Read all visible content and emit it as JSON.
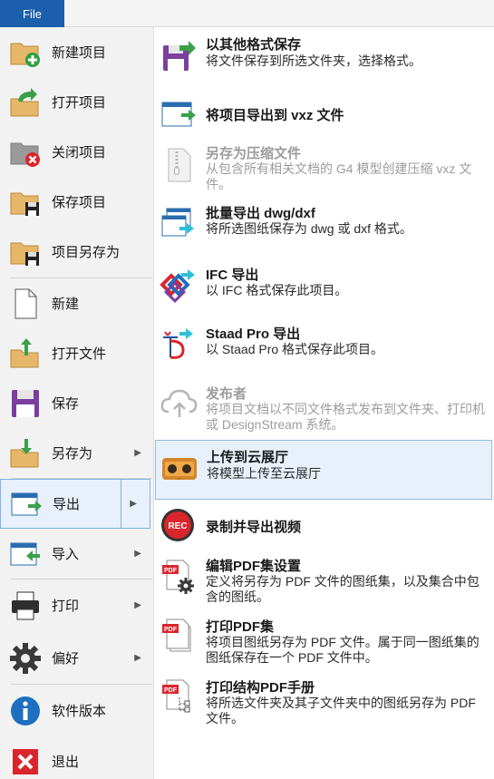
{
  "tab": {
    "label": "File"
  },
  "left_menu": {
    "new_project": "新建项目",
    "open_project": "打开项目",
    "close_project": "关闭项目",
    "save_project": "保存项目",
    "save_project_as": "项目另存为",
    "new": "新建",
    "open_file": "打开文件",
    "save": "保存",
    "save_as": "另存为",
    "export": "导出",
    "import": "导入",
    "print": "打印",
    "preferences": "偏好",
    "version": "软件版本",
    "exit": "退出"
  },
  "submenu": {
    "save_other_format": {
      "title": "以其他格式保存",
      "desc": "将文件保存到所选文件夹，选择格式。"
    },
    "export_vxz": {
      "title": "将项目导出到 vxz 文件",
      "desc": ""
    },
    "save_compressed": {
      "title": "另存为压缩文件",
      "desc": "从包含所有相关文档的 G4 模型创建压缩 vxz 文件。"
    },
    "batch_dwg": {
      "title": "批量导出 dwg/dxf",
      "desc": "将所选图纸保存为 dwg 或 dxf 格式。"
    },
    "ifc": {
      "title": "IFC 导出",
      "desc": "以 IFC 格式保存此项目。"
    },
    "staad": {
      "title": "Staad Pro 导出",
      "desc": "以 Staad Pro 格式保存此项目。"
    },
    "publisher": {
      "title": "发布者",
      "desc": "将项目文档以不同文件格式发布到文件夹、打印机或 DesignStream 系统。"
    },
    "cloud": {
      "title": "上传到云展厅",
      "desc": "将模型上传至云展厅"
    },
    "record": {
      "title": "录制并导出视频",
      "desc": ""
    },
    "pdf_settings": {
      "title": "编辑PDF集设置",
      "desc": "定义将另存为 PDF 文件的图纸集，以及集合中包含的图纸。"
    },
    "print_pdf": {
      "title": "打印PDF集",
      "desc": "将项目图纸另存为 PDF 文件。属于同一图纸集的图纸保存在一个 PDF 文件中。"
    },
    "print_pdf_manual": {
      "title": "打印结构PDF手册",
      "desc": "将所选文件夹及其子文件夹中的图纸另存为 PDF 文件。"
    }
  },
  "icons": {
    "rec_label": "REC",
    "pdf_label": "PDF"
  },
  "colors": {
    "file_tab": "#1c5fac",
    "highlight": "#e8f1fb",
    "highlight_border": "#7fb0e3",
    "disabled_text": "#9c9c9c"
  }
}
